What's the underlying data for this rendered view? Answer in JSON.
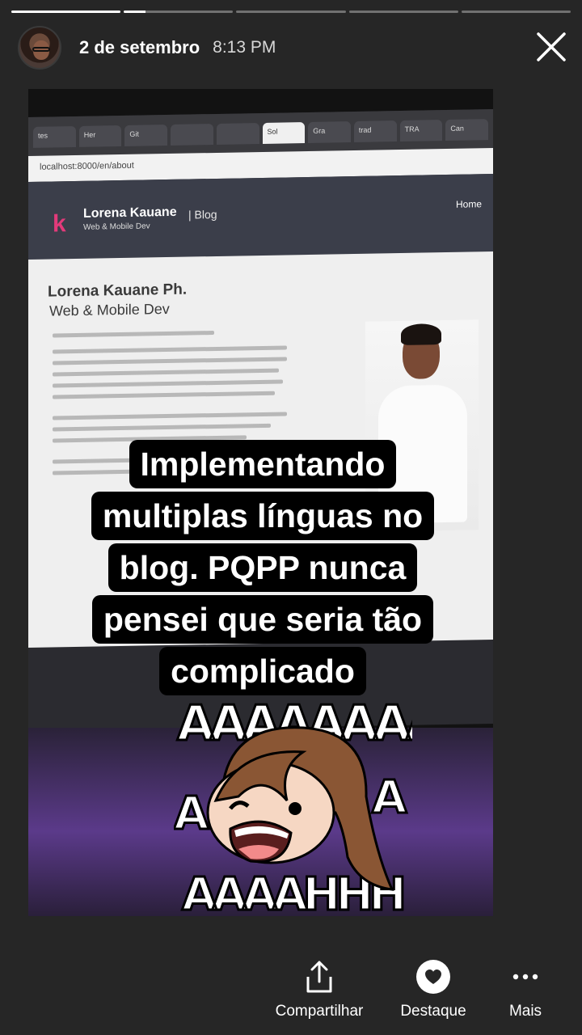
{
  "story": {
    "progress": [
      1.0,
      0.2,
      0.0,
      0.0,
      0.0
    ],
    "date": "2 de setembro",
    "time": "8:13 PM"
  },
  "screen": {
    "tabs": [
      "tes",
      "Her",
      "Git",
      "",
      "",
      "Sol",
      "Gra",
      "trad",
      "TRA",
      "Can"
    ],
    "url": "localhost:8000/en/about",
    "site_brand": "Lorena Kauane",
    "site_brand_sub": "Web & Mobile Dev",
    "site_blog": "| Blog",
    "site_home": "Home",
    "page_title": "Lorena Kauane Ph.",
    "page_subtitle": "Web & Mobile Dev"
  },
  "caption_lines": [
    "Implementando",
    "multiplas línguas no",
    "blog. PQPP nunca",
    "pensei que seria tão",
    "complicado"
  ],
  "sticker": {
    "icon": "screaming-girl-sticker",
    "text": "AAAAAAAA"
  },
  "actions": {
    "share": "Compartilhar",
    "highlight": "Destaque",
    "more": "Mais"
  }
}
